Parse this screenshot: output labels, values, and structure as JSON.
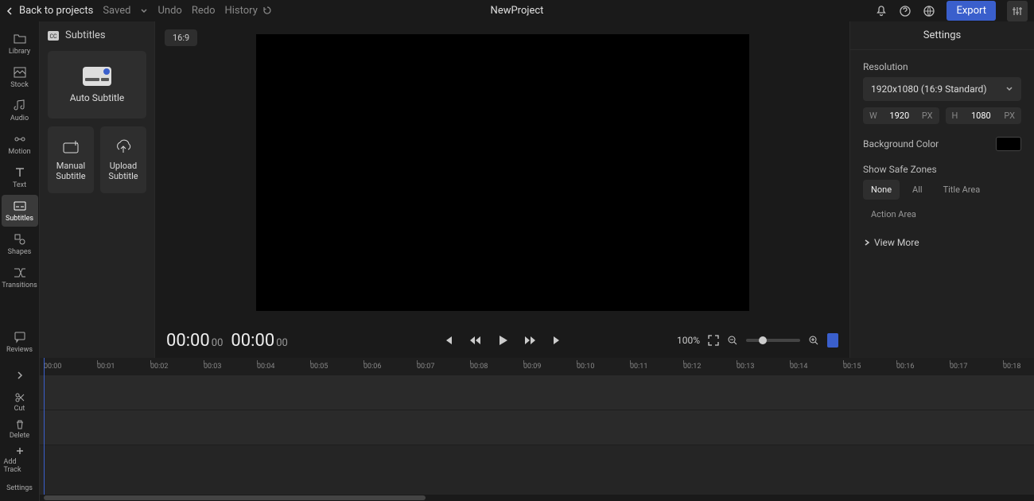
{
  "topbar": {
    "back": "Back to projects",
    "saved": "Saved",
    "undo": "Undo",
    "redo": "Redo",
    "history": "History",
    "project_name": "NewProject",
    "export": "Export"
  },
  "rail": {
    "items": [
      {
        "label": "Library"
      },
      {
        "label": "Stock"
      },
      {
        "label": "Audio"
      },
      {
        "label": "Motion"
      },
      {
        "label": "Text"
      },
      {
        "label": "Subtitles"
      },
      {
        "label": "Shapes"
      },
      {
        "label": "Transitions"
      },
      {
        "label": "Reviews"
      }
    ]
  },
  "panel": {
    "title": "Subtitles",
    "auto": "Auto Subtitle",
    "manual": "Manual\nSubtitle",
    "upload": "Upload\nSubtitle"
  },
  "preview": {
    "ratio": "16:9",
    "time_current": "00:00",
    "time_current_frames": "00",
    "time_total": "00:00",
    "time_total_frames": "00",
    "zoom": "100%"
  },
  "settings": {
    "title": "Settings",
    "resolution_label": "Resolution",
    "resolution_value": "1920x1080 (16:9 Standard)",
    "w_label": "W",
    "w_value": "1920",
    "w_unit": "PX",
    "h_label": "H",
    "h_value": "1080",
    "h_unit": "PX",
    "bg_label": "Background Color",
    "zones_label": "Show Safe Zones",
    "zones": [
      "None",
      "All",
      "Title Area",
      "Action Area"
    ],
    "view_more": "View More"
  },
  "timeline": {
    "tools": {
      "cut": "Cut",
      "delete": "Delete",
      "add_track": "Add Track",
      "settings": "Settings"
    },
    "ticks": [
      "00:00",
      "00:01",
      "00:02",
      "00:03",
      "00:04",
      "00:05",
      "00:06",
      "00:07",
      "00:08",
      "00:09",
      "00:10",
      "00:11",
      "00:12",
      "00:13",
      "00:14",
      "00:15",
      "00:16",
      "00:17",
      "00:18"
    ]
  }
}
